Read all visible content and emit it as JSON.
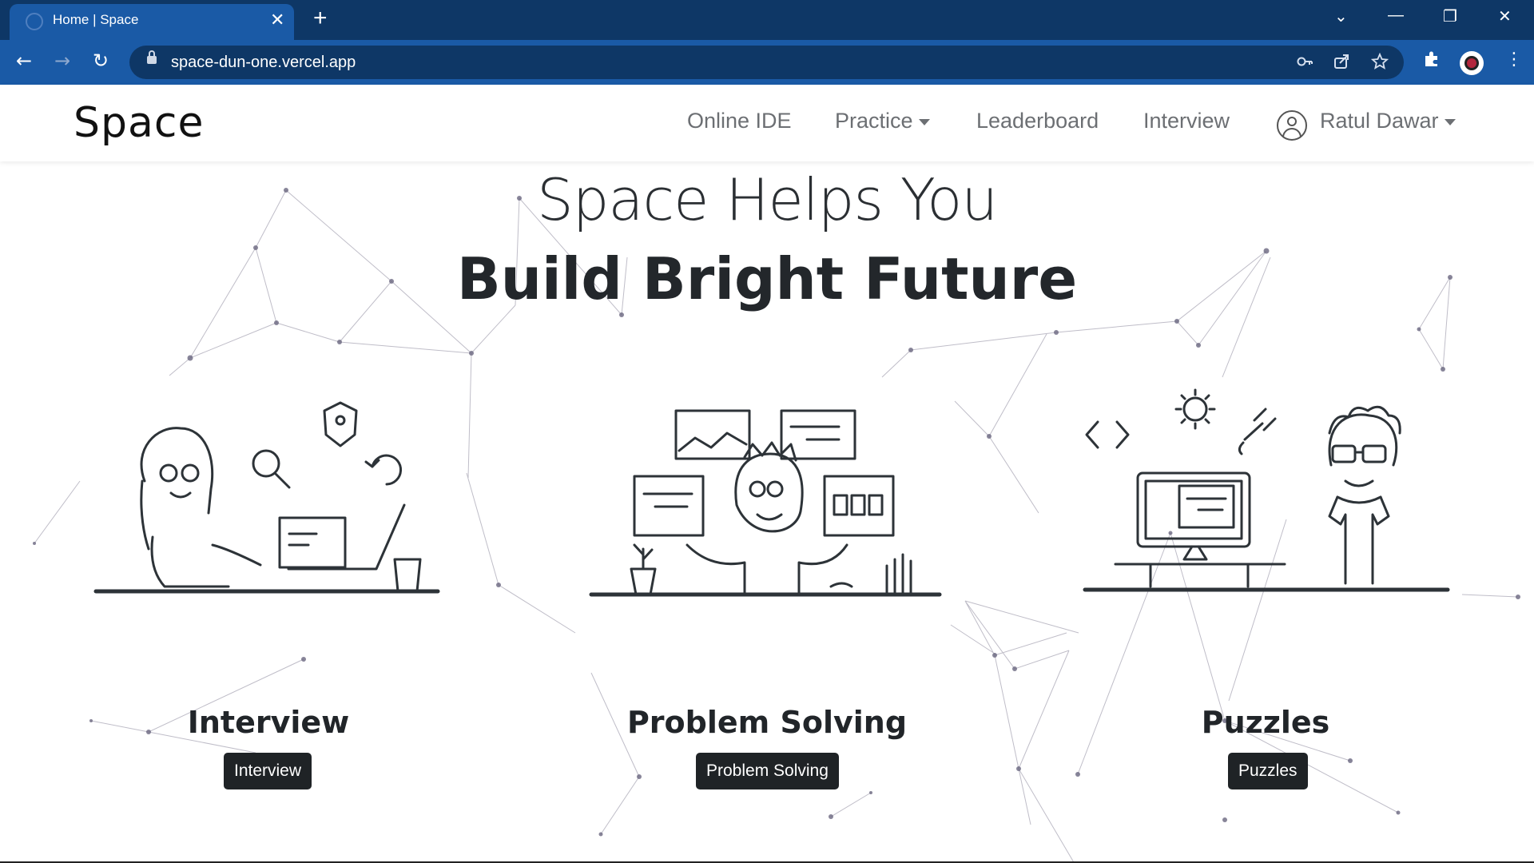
{
  "browser": {
    "tab_title": "Home | Space",
    "tab_close": "✕",
    "new_tab": "+",
    "url": "space-dun-one.vercel.app",
    "window_controls": {
      "dropdown": "⌄",
      "minimize": "—",
      "restore": "❐",
      "close": "✕"
    },
    "nav": {
      "back": "←",
      "forward": "→",
      "reload": "↻"
    },
    "omnibox_icons": [
      "key-icon",
      "share-icon",
      "star-icon"
    ],
    "extensions_icon": "puzzle-piece-icon",
    "menu_icon": "⋮"
  },
  "site": {
    "brand": "Space",
    "nav": {
      "online_ide": "Online IDE",
      "practice": "Practice",
      "leaderboard": "Leaderboard",
      "interview": "Interview",
      "user": "Ratul Dawar"
    }
  },
  "hero": {
    "line1": "Space Helps You",
    "line2": "Build Bright Future"
  },
  "cards": [
    {
      "title": "Interview",
      "button": "Interview"
    },
    {
      "title": "Problem Solving",
      "button": "Problem Solving"
    },
    {
      "title": "Puzzles",
      "button": "Puzzles"
    }
  ],
  "colors": {
    "chrome_dark": "#0e3766",
    "chrome_tab": "#1a5aa6",
    "text_dark": "#212529",
    "button_bg": "#1f2326",
    "nav_text": "#6c6f73"
  }
}
